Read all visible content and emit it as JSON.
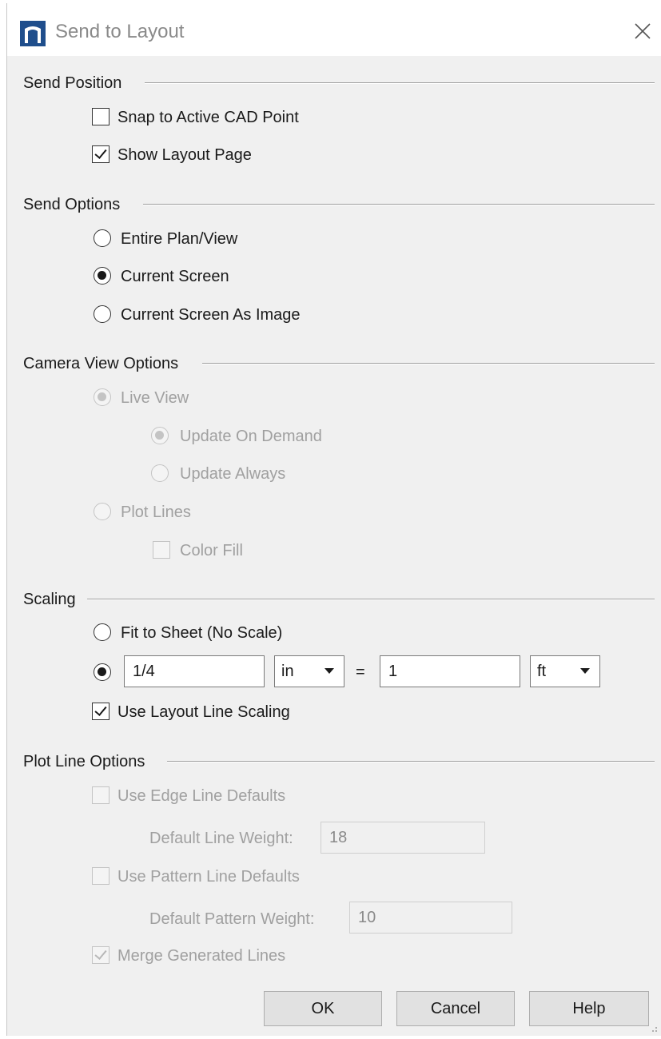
{
  "window": {
    "title": "Send to Layout",
    "icon": "chief-architect-logo-icon"
  },
  "sections": {
    "send_position": {
      "title": "Send Position",
      "snap_label": "Snap to Active CAD Point",
      "snap_checked": false,
      "show_page_label": "Show Layout Page",
      "show_page_checked": true
    },
    "send_options": {
      "title": "Send Options",
      "entire_label": "Entire Plan/View",
      "current_label": "Current Screen",
      "image_label": "Current Screen As Image",
      "selected": "Current Screen"
    },
    "camera_view": {
      "title": "Camera View Options",
      "live_label": "Live View",
      "demand_label": "Update On Demand",
      "always_label": "Update Always",
      "plot_label": "Plot Lines",
      "color_fill_label": "Color Fill",
      "enabled": false
    },
    "scaling": {
      "title": "Scaling",
      "fit_label": "Fit to Sheet (No Scale)",
      "scale_value": "1/4",
      "scale_unit": "in",
      "equals": "=",
      "real_value": "1",
      "real_unit": "ft",
      "line_scaling_label": "Use Layout Line Scaling",
      "line_scaling_checked": true
    },
    "plot_line": {
      "title": "Plot Line Options",
      "edge_label": "Use Edge Line Defaults",
      "line_weight_label": "Default Line Weight:",
      "line_weight_value": "18",
      "pattern_label": "Use Pattern Line Defaults",
      "pattern_weight_label": "Default Pattern Weight:",
      "pattern_weight_value": "10",
      "merge_label": "Merge Generated Lines",
      "merge_checked": true,
      "enabled": false
    }
  },
  "buttons": {
    "ok": "OK",
    "cancel": "Cancel",
    "help": "Help"
  },
  "colors": {
    "accent_icon": "#1f4e8c",
    "dialog_bg": "#f0f0f0",
    "disabled_text": "#a0a0a0"
  }
}
